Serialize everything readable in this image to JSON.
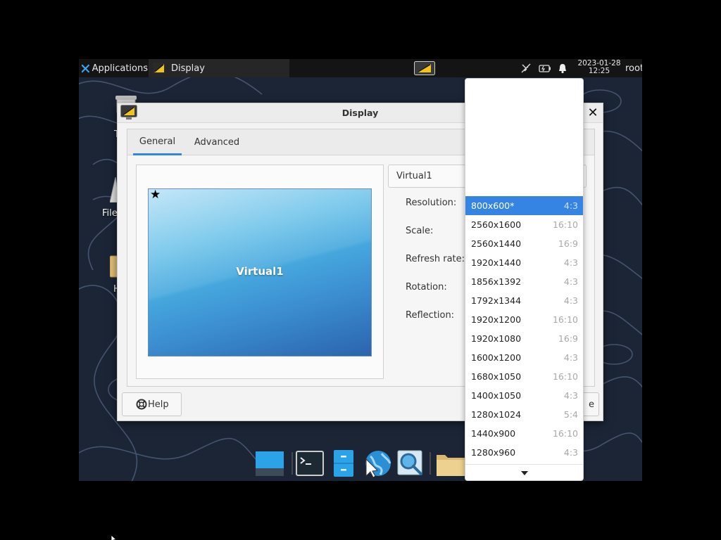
{
  "top_panel": {
    "applications_label": "Applications",
    "window_task_label": "Display",
    "clock_date": "2023-01-28",
    "clock_time": "12:25",
    "user_name": "root",
    "icons": [
      "applications-menu-icon",
      "display-settings-icon",
      "network-disconnected-icon",
      "battery-icon",
      "notification-bell-icon"
    ]
  },
  "desktop": {
    "partial_labels": [
      "T",
      "File",
      "H"
    ]
  },
  "display_window": {
    "title": "Display",
    "tabs": [
      {
        "label": "General",
        "active": true
      },
      {
        "label": "Advanced",
        "active": false
      }
    ],
    "monitor_label": "Virtual1",
    "output_combo_value": "Virtual1",
    "properties": [
      "Resolution:",
      "Scale:",
      "Refresh rate:",
      "Rotation:",
      "Reflection:"
    ],
    "help_label": "Help",
    "close_label_partial": "e"
  },
  "resolution_dropdown": {
    "selected": "800x600*",
    "items": [
      {
        "res": "800x600*",
        "ratio": "4:3",
        "selected": true
      },
      {
        "res": "2560x1600",
        "ratio": "16:10"
      },
      {
        "res": "2560x1440",
        "ratio": "16:9"
      },
      {
        "res": "1920x1440",
        "ratio": "4:3"
      },
      {
        "res": "1856x1392",
        "ratio": "4:3"
      },
      {
        "res": "1792x1344",
        "ratio": "4:3"
      },
      {
        "res": "1920x1200",
        "ratio": "16:10"
      },
      {
        "res": "1920x1080",
        "ratio": "16:9"
      },
      {
        "res": "1600x1200",
        "ratio": "4:3"
      },
      {
        "res": "1680x1050",
        "ratio": "16:10"
      },
      {
        "res": "1400x1050",
        "ratio": "4:3"
      },
      {
        "res": "1280x1024",
        "ratio": "5:4"
      },
      {
        "res": "1440x900",
        "ratio": "16:10"
      },
      {
        "res": "1280x960",
        "ratio": "4:3"
      }
    ]
  },
  "dock": {
    "items": [
      "show-desktop-icon",
      "terminal-icon",
      "file-manager-icon",
      "web-browser-icon",
      "app-finder-icon",
      "home-folder-icon"
    ]
  },
  "colors": {
    "accent": "#3584e4",
    "panel_bg": "#141414",
    "desktop_bg": "#1b2536"
  }
}
